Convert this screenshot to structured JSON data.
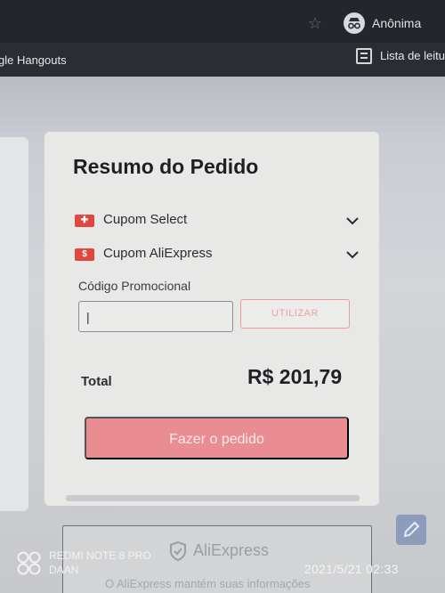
{
  "browser": {
    "incognito_label": "Anônima",
    "bookmark_left": "gle Hangouts",
    "reading_list_label": "Lista de leitu"
  },
  "summary": {
    "title": "Resumo do Pedido",
    "coupons": [
      {
        "label": "Cupom Select",
        "icon": "select-coupon-icon"
      },
      {
        "label": "Cupom AliExpress",
        "icon": "aliexpress-coupon-icon"
      }
    ],
    "promo_label": "Código Promocional",
    "promo_value": "|",
    "promo_button": "UTILIZAR",
    "total_label": "Total",
    "total_value": "R$ 201,79",
    "order_button": "Fazer o pedido"
  },
  "footer": {
    "brand": "AliExpress",
    "note": "O AliExpress mantém suas informações"
  },
  "watermark": {
    "device": "REDMI NOTE 8 PRO",
    "user": "DAAN",
    "datetime": "2021/5/21 02:33"
  },
  "colors": {
    "accent": "#ea8d92",
    "coupon_red": "#e0473f"
  }
}
